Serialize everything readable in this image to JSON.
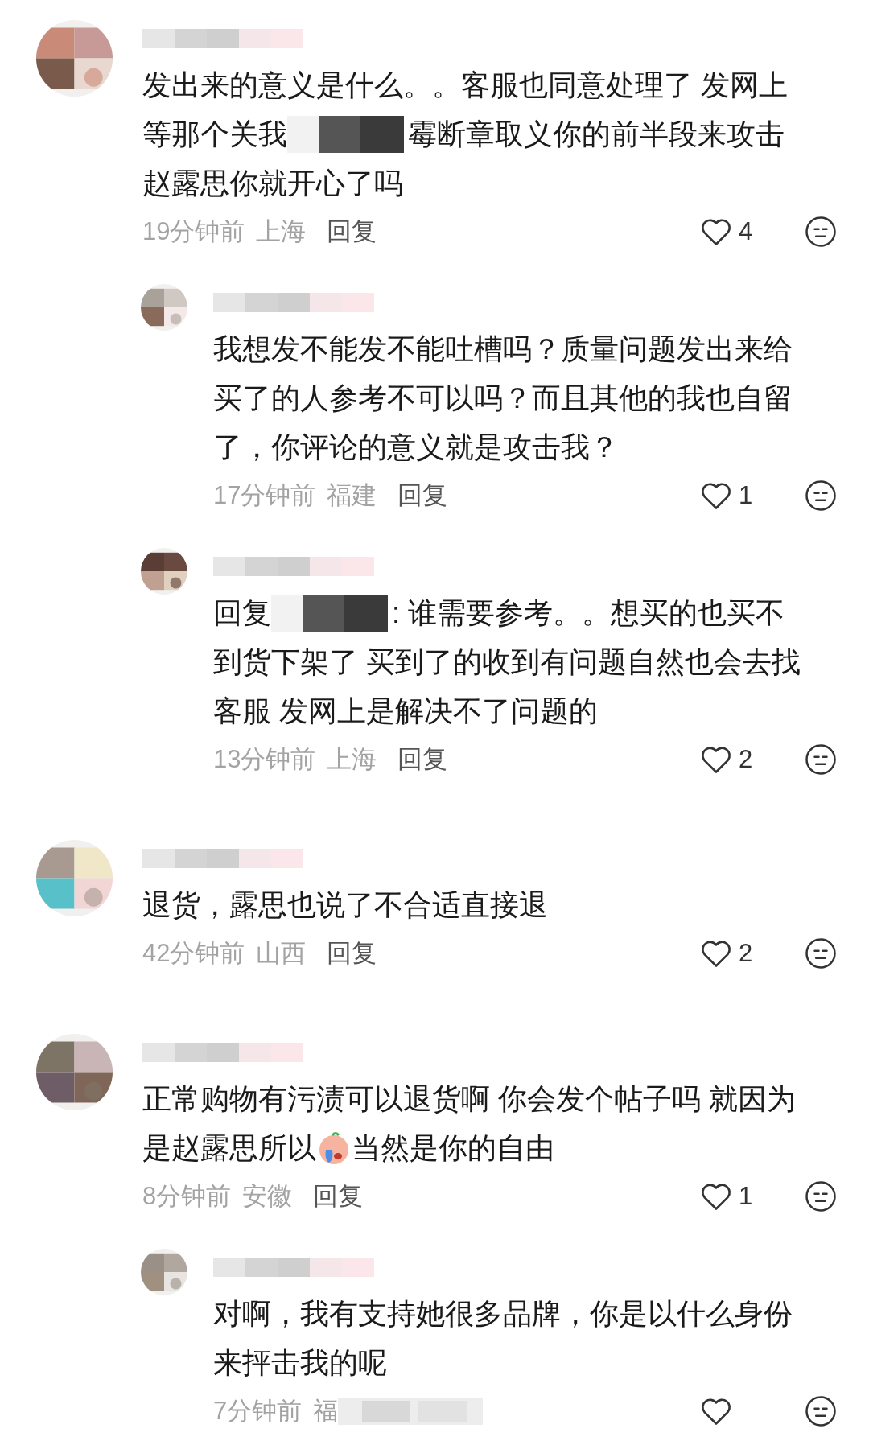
{
  "comments": [
    {
      "lines": [
        [
          {
            "kind": "text",
            "text": "发出来的意义是什么。。客服也同意处理了 发网上"
          }
        ],
        [
          {
            "kind": "text",
            "text": "等那个关我"
          },
          {
            "kind": "redaction"
          },
          {
            "kind": "text",
            "text": "霉断章取义你的前半段来攻击"
          }
        ],
        [
          {
            "kind": "text",
            "text": "赵露思你就开心了吗"
          }
        ]
      ],
      "time": "19分钟前",
      "location": "上海",
      "location_cut": false,
      "reply_label": "回复",
      "likes": "4",
      "children": [
        {
          "lines": [
            [
              {
                "kind": "text",
                "text": "我想发不能发不能吐槽吗？质量问题发出来给"
              }
            ],
            [
              {
                "kind": "text",
                "text": "买了的人参考不可以吗？而且其他的我也自留"
              }
            ],
            [
              {
                "kind": "text",
                "text": "了，你评论的意义就是攻击我？"
              }
            ]
          ],
          "time": "17分钟前",
          "location": "福建",
          "location_cut": false,
          "reply_label": "回复",
          "likes": "1"
        },
        {
          "lines": [
            [
              {
                "kind": "text",
                "text": "回复"
              },
              {
                "kind": "redaction"
              },
              {
                "kind": "text",
                "text": ": 谁需要参考。。想买的也买不"
              }
            ],
            [
              {
                "kind": "text",
                "text": "到货下架了 买到了的收到有问题自然也会去找"
              }
            ],
            [
              {
                "kind": "text",
                "text": "客服 发网上是解决不了问题的"
              }
            ]
          ],
          "time": "13分钟前",
          "location": "上海",
          "location_cut": false,
          "reply_label": "回复",
          "likes": "2"
        }
      ]
    },
    {
      "lines": [
        [
          {
            "kind": "text",
            "text": "退货，露思也说了不合适直接退"
          }
        ]
      ],
      "time": "42分钟前",
      "location": "山西",
      "location_cut": false,
      "reply_label": "回复",
      "likes": "2"
    },
    {
      "lines": [
        [
          {
            "kind": "text",
            "text": "正常购物有污渍可以退货啊 你会发个帖子吗 就因为"
          }
        ],
        [
          {
            "kind": "text",
            "text": "是赵露思所以"
          },
          {
            "kind": "emoji"
          },
          {
            "kind": "text",
            "text": "当然是你的自由"
          }
        ]
      ],
      "time": "8分钟前",
      "location": "安徽",
      "location_cut": false,
      "reply_label": "回复",
      "likes": "1",
      "children": [
        {
          "lines": [
            [
              {
                "kind": "text",
                "text": "对啊，我有支持她很多品牌，你是以什么身份"
              }
            ],
            [
              {
                "kind": "text",
                "text": "来抨击我的呢"
              }
            ]
          ],
          "time": "7分钟前",
          "location": "福",
          "location_cut": true
        }
      ]
    }
  ]
}
